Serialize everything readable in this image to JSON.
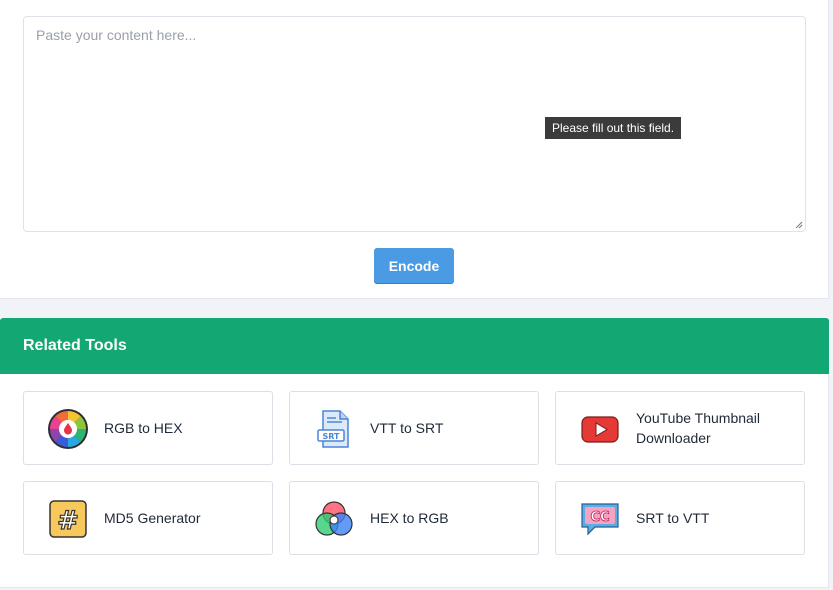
{
  "editor": {
    "placeholder": "Paste your content here...",
    "validation_tooltip": "Please fill out this field."
  },
  "actions": {
    "encode_label": "Encode"
  },
  "related_tools": {
    "title": "Related Tools",
    "items": [
      {
        "label": "RGB to HEX",
        "icon": "color-wheel-icon"
      },
      {
        "label": "VTT to SRT",
        "icon": "srt-file-icon"
      },
      {
        "label": "YouTube Thumbnail Downloader",
        "icon": "youtube-icon"
      },
      {
        "label": "MD5 Generator",
        "icon": "hash-icon"
      },
      {
        "label": "HEX to RGB",
        "icon": "rgb-circles-icon"
      },
      {
        "label": "SRT to VTT",
        "icon": "cc-bubble-icon"
      }
    ]
  },
  "colors": {
    "header_green": "#13a774",
    "button_blue": "#4a9be4"
  }
}
